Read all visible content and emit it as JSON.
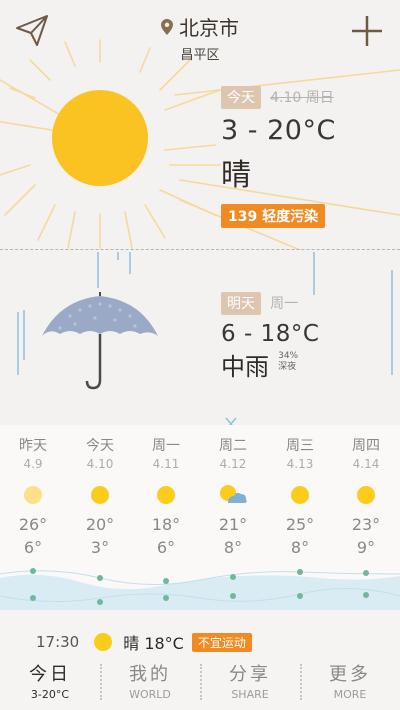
{
  "header": {
    "city": "北京市",
    "district": "昌平区"
  },
  "today": {
    "tag": "今天",
    "date": "4.10 周日",
    "temp": "3 - 20°C",
    "condition": "晴",
    "aqi": "139 轻度污染"
  },
  "tomorrow": {
    "tag": "明天",
    "weekday": "周一",
    "temp": "6 - 18°C",
    "condition": "中雨",
    "rain_prob": "34%",
    "rain_time": "深夜"
  },
  "forecast": [
    {
      "day": "昨天",
      "date": "4.9",
      "icon": "sun-icon",
      "icon_color": "#fde08a",
      "hi": "26°",
      "lo": "6°"
    },
    {
      "day": "今天",
      "date": "4.10",
      "icon": "sun-icon",
      "icon_color": "#fbcc1c",
      "hi": "20°",
      "lo": "3°"
    },
    {
      "day": "周一",
      "date": "4.11",
      "icon": "sun-icon",
      "icon_color": "#fbcc1c",
      "hi": "18°",
      "lo": "6°"
    },
    {
      "day": "周二",
      "date": "4.12",
      "icon": "partly-cloudy-icon",
      "icon_color": "#fbcc1c",
      "hi": "21°",
      "lo": "8°"
    },
    {
      "day": "周三",
      "date": "4.13",
      "icon": "sun-icon",
      "icon_color": "#fbcc1c",
      "hi": "25°",
      "lo": "8°"
    },
    {
      "day": "周四",
      "date": "4.14",
      "icon": "sun-icon",
      "icon_color": "#fbcc1c",
      "hi": "23°",
      "lo": "9°"
    }
  ],
  "now": {
    "time": "17:30",
    "text": "晴 18°C",
    "badge": "不宜运动"
  },
  "nav": [
    {
      "main": "今日",
      "sub": "3-20°C"
    },
    {
      "main": "我的",
      "sub": "WORLD"
    },
    {
      "main": "分享",
      "sub": "SHARE"
    },
    {
      "main": "更多",
      "sub": "MORE"
    }
  ],
  "colors": {
    "accent_orange": "#f08a22",
    "tag_beige": "#dcc6b0",
    "sun_yellow": "#fbcc1c",
    "rain_blue": "#7fb6d6",
    "wave_blue": "#d6ebf3"
  }
}
